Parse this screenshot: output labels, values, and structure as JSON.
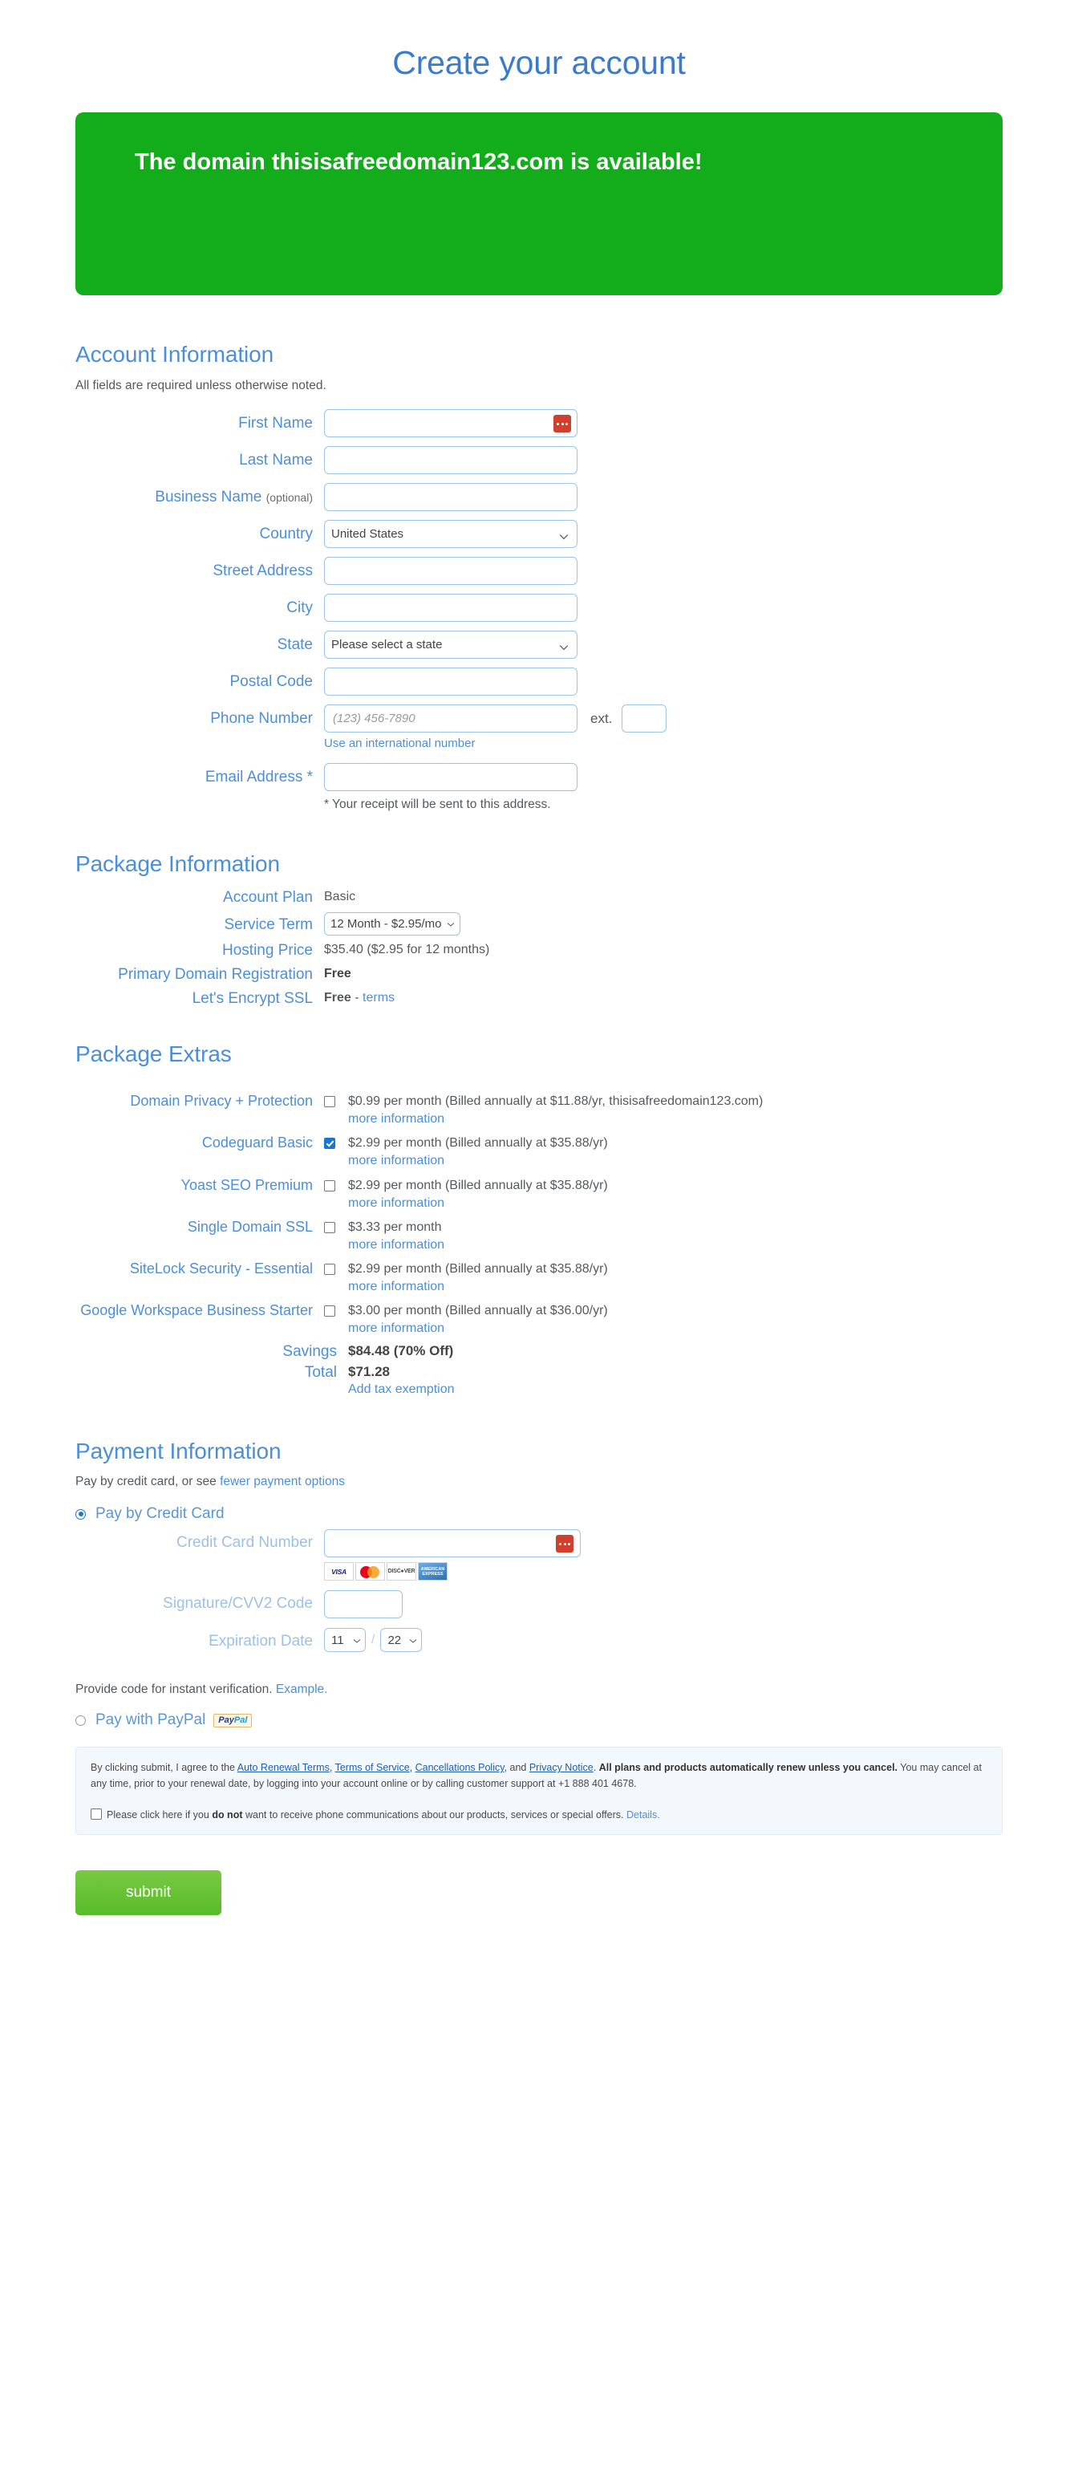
{
  "page": {
    "title": "Create your account",
    "banner_text": "The domain thisisafreedomain123.com is available!",
    "banner_color": "#13ad1b",
    "accent_color": "#4c8fd8"
  },
  "account_information": {
    "heading": "Account Information",
    "note": "All fields are required unless otherwise noted.",
    "fields": {
      "first_name_label": "First Name",
      "first_name_value": "",
      "last_name_label": "Last Name",
      "last_name_value": "",
      "business_name_label": "Business Name",
      "business_name_optional": "(optional)",
      "business_name_value": "",
      "country_label": "Country",
      "country_value": "United States",
      "street_label": "Street Address",
      "street_value": "",
      "city_label": "City",
      "city_value": "",
      "state_label": "State",
      "state_value": "Please select a state",
      "postal_label": "Postal Code",
      "postal_value": "",
      "phone_label": "Phone Number",
      "phone_placeholder": "(123) 456-7890",
      "phone_value": "",
      "phone_helper": "Use an international number",
      "ext_label": "ext.",
      "ext_value": "",
      "email_label": "Email Address *",
      "email_value": "",
      "email_note": "* Your receipt will be sent to this address."
    }
  },
  "package_information": {
    "heading": "Package Information",
    "rows": [
      {
        "label": "Account Plan",
        "value": "Basic",
        "bold": false
      },
      {
        "label": "Service Term",
        "value": "12 Month - $2.95/mo",
        "bold": false
      },
      {
        "label": "Hosting Price",
        "value": "$35.40 ($2.95 for 12 months)",
        "bold": false
      },
      {
        "label": "Primary Domain Registration",
        "value": "Free",
        "bold": true
      },
      {
        "label": "Let's Encrypt SSL",
        "value": "Free",
        "bold": true
      }
    ],
    "account_plan_label": "Account Plan",
    "account_plan_value": "Basic",
    "service_term_label": "Service Term",
    "service_term_value": "12 Month - $2.95/mo",
    "hosting_price_label": "Hosting Price",
    "hosting_price_value": "$35.40 ($2.95 for 12 months)",
    "primary_domain_label": "Primary Domain Registration",
    "primary_domain_value": "Free",
    "ssl_label": "Let's Encrypt SSL",
    "ssl_value": "Free",
    "ssl_sep": " - ",
    "ssl_terms_link": "terms"
  },
  "package_extras": {
    "heading": "Package Extras",
    "more_info_label": "more information",
    "items": [
      {
        "label": "Domain Privacy + Protection",
        "checked": false,
        "price_text": "$0.99 per month (Billed annually at $11.88/yr, thisisafreedomain123.com)"
      },
      {
        "label": "Codeguard Basic",
        "checked": true,
        "price_text": "$2.99 per month (Billed annually at $35.88/yr)"
      },
      {
        "label": "Yoast SEO Premium",
        "checked": false,
        "price_text": "$2.99 per month (Billed annually at $35.88/yr)"
      },
      {
        "label": "Single Domain SSL",
        "checked": false,
        "price_text": "$3.33 per month"
      },
      {
        "label": "SiteLock Security - Essential",
        "checked": false,
        "price_text": "$2.99 per month (Billed annually at $35.88/yr)"
      },
      {
        "label": "Google Workspace Business Starter",
        "checked": false,
        "price_text": "$3.00 per month (Billed annually at $36.00/yr)"
      }
    ],
    "savings_label": "Savings",
    "savings_value": "$84.48 (70% Off)",
    "total_label": "Total",
    "total_value": "$71.28",
    "tax_exemption_link": "Add tax exemption"
  },
  "payment_information": {
    "heading": "Payment Information",
    "subtext_prefix": "Pay by credit card, or see ",
    "subtext_link": "fewer payment options",
    "credit_card_option": "Pay by Credit Card",
    "credit_card_selected": true,
    "card_number_label": "Credit Card Number",
    "card_number_value": "",
    "cvv_label": "Signature/CVV2 Code",
    "cvv_value": "",
    "expiration_label": "Expiration Date",
    "expiration_month": "11",
    "expiration_year": "22",
    "card_logos": [
      "VISA",
      "MasterCard",
      "DISCOVER",
      "American Express"
    ],
    "verify_text": "Provide code for instant verification. ",
    "verify_link": "Example.",
    "paypal_option": "Pay with PayPal",
    "paypal_selected": false,
    "paypal_badge_pay": "Pay",
    "paypal_badge_pal": "Pal"
  },
  "terms": {
    "line1_a": "By clicking submit, I agree to the ",
    "link_auto_renewal": "Auto Renewal Terms",
    "sep1": ", ",
    "link_tos": "Terms of Service",
    "sep2": ", ",
    "link_cancellations": "Cancellations Policy",
    "sep3": ", and ",
    "link_privacy": "Privacy Notice",
    "sep4": ". ",
    "bold_part": "All plans and products automatically renew unless you cancel.",
    "line1_b": " You may cancel at any time, prior to your renewal date, by logging into your account online or by calling customer support at +1 888 401 4678.",
    "optout_a": "Please click here if you ",
    "optout_bold": "do not",
    "optout_b": " want to receive phone communications about our products, services or special offers. ",
    "optout_link": "Details.",
    "optout_checked": false
  },
  "submit": {
    "label": "submit"
  }
}
